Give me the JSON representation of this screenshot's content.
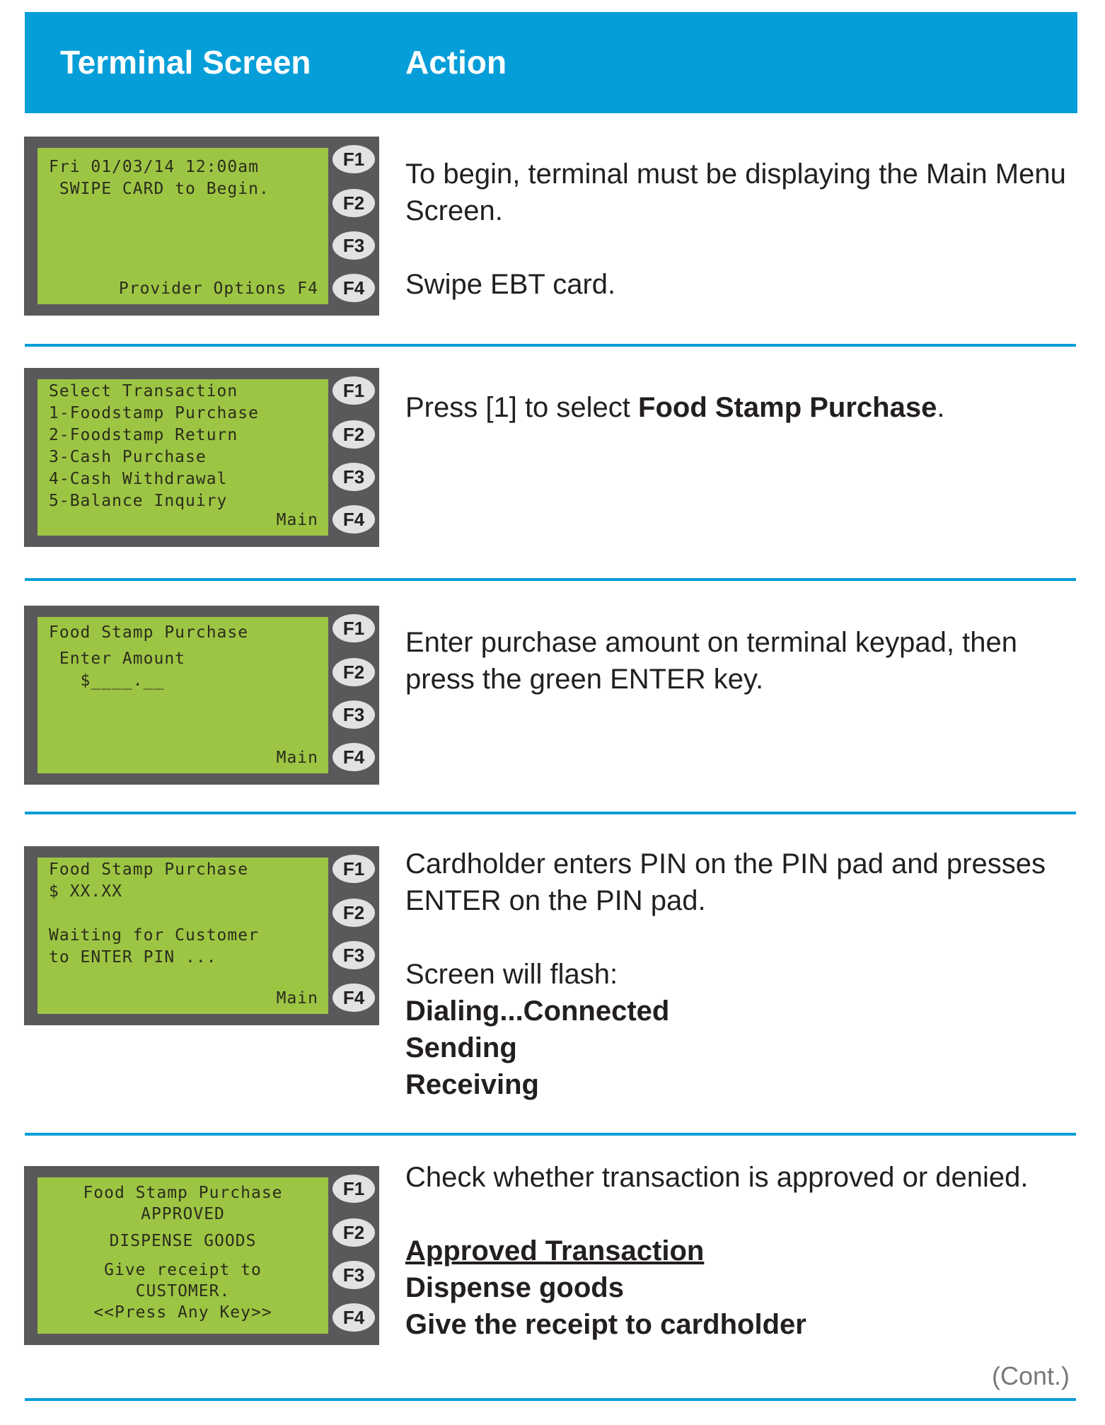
{
  "header": {
    "col1": "Terminal Screen",
    "col2": "Action",
    "color": "#069ED8"
  },
  "fkeys": [
    "F1",
    "F2",
    "F3",
    "F4"
  ],
  "rows": [
    {
      "screen": {
        "lines": [
          "Fri 01/03/14 12:00am",
          " SWIPE CARD to Begin."
        ],
        "footer": "Provider Options F4"
      },
      "action": {
        "p1": "To begin, terminal must be displaying the Main Menu Screen.",
        "p2": "Swipe EBT card."
      }
    },
    {
      "screen": {
        "lines": [
          "Select Transaction",
          "1-Foodstamp Purchase",
          "2-Foodstamp Return",
          "3-Cash Purchase",
          "4-Cash Withdrawal",
          "5-Balance Inquiry"
        ],
        "footer": "Main"
      },
      "action": {
        "prefix": "Press [1] to select ",
        "bold": "Food Stamp Purchase",
        "suffix": "."
      }
    },
    {
      "screen": {
        "lines": [
          "Food Stamp Purchase",
          " Enter Amount",
          "   $____.__"
        ],
        "footer": "Main"
      },
      "action": {
        "p1": "Enter purchase amount on terminal keypad, then press the green ENTER key."
      }
    },
    {
      "screen": {
        "lines": [
          "Food Stamp Purchase",
          "$ XX.XX",
          "",
          "Waiting for Customer",
          "to ENTER PIN ..."
        ],
        "footer": "Main"
      },
      "action": {
        "p1": "Cardholder enters PIN on the PIN pad and presses ENTER on the PIN pad.",
        "p2": "Screen will flash:",
        "bold_lines": [
          "Dialing...Connected",
          "Sending",
          "Receiving"
        ]
      }
    },
    {
      "screen": {
        "lines": [
          "Food Stamp Purchase",
          "APPROVED",
          "DISPENSE GOODS",
          "Give receipt to",
          "CUSTOMER.",
          "<<Press Any Key>>"
        ]
      },
      "action": {
        "p1": "Check whether transaction is approved or denied.",
        "underline_heading": "Approved Transaction",
        "bold_lines": [
          "Dispense goods",
          "Give the receipt to cardholder"
        ]
      }
    }
  ],
  "footer": {
    "continued": "(Cont.)"
  }
}
